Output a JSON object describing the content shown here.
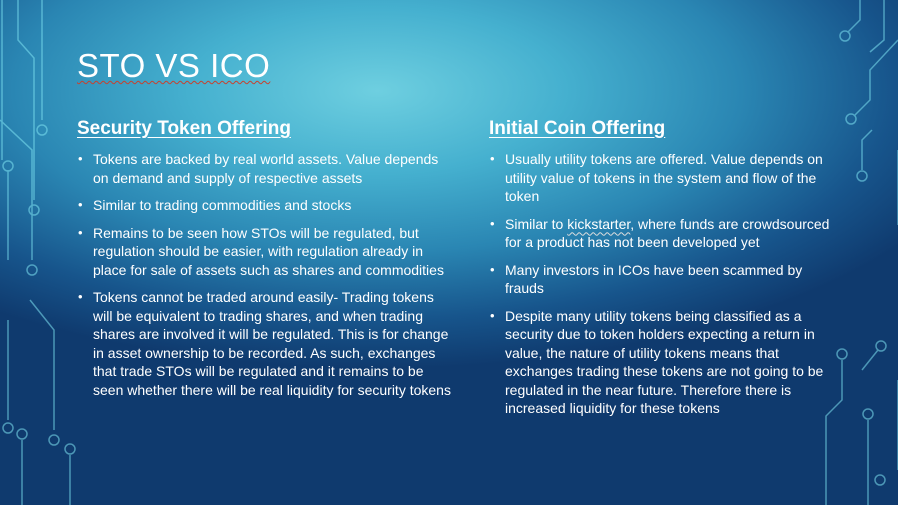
{
  "slide": {
    "title": "STO VS ICO",
    "colors": {
      "bg_light": "#6ecfe0",
      "bg_dark": "#0f3a6e",
      "circuit": "#7ee3f2",
      "text": "#ffffff"
    },
    "bullet_glyph": "•",
    "left": {
      "heading": "Security Token Offering",
      "bullets": [
        "Tokens are backed by real world assets. Value depends on demand and supply of respective assets",
        "Similar to trading commodities and stocks",
        "Remains to be seen how STOs will be regulated, but regulation should be easier, with regulation already in place for sale of  assets such as shares and commodities",
        "Tokens cannot be traded around easily- Trading tokens will be equivalent to trading shares, and when trading shares are involved it will be regulated. This is for change in asset ownership to be recorded. As such, exchanges that trade STOs will be regulated and it remains to be seen whether there will be real liquidity for security tokens"
      ]
    },
    "right": {
      "heading": "Initial Coin Offering",
      "bullets": [
        "Usually utility tokens are offered. Value depends on utility value of tokens in the system and flow of the token",
        {
          "before": "Similar to ",
          "highlight": "kickstarter",
          "after": ", where funds are crowdsourced for a product has not been developed yet"
        },
        "Many investors in ICOs have been scammed by frauds",
        "Despite many utility tokens being classified as a security due to token holders expecting a return in value, the nature of utility tokens means that exchanges trading these tokens are not going to be regulated in the near future. Therefore there is increased liquidity for these tokens"
      ]
    }
  }
}
